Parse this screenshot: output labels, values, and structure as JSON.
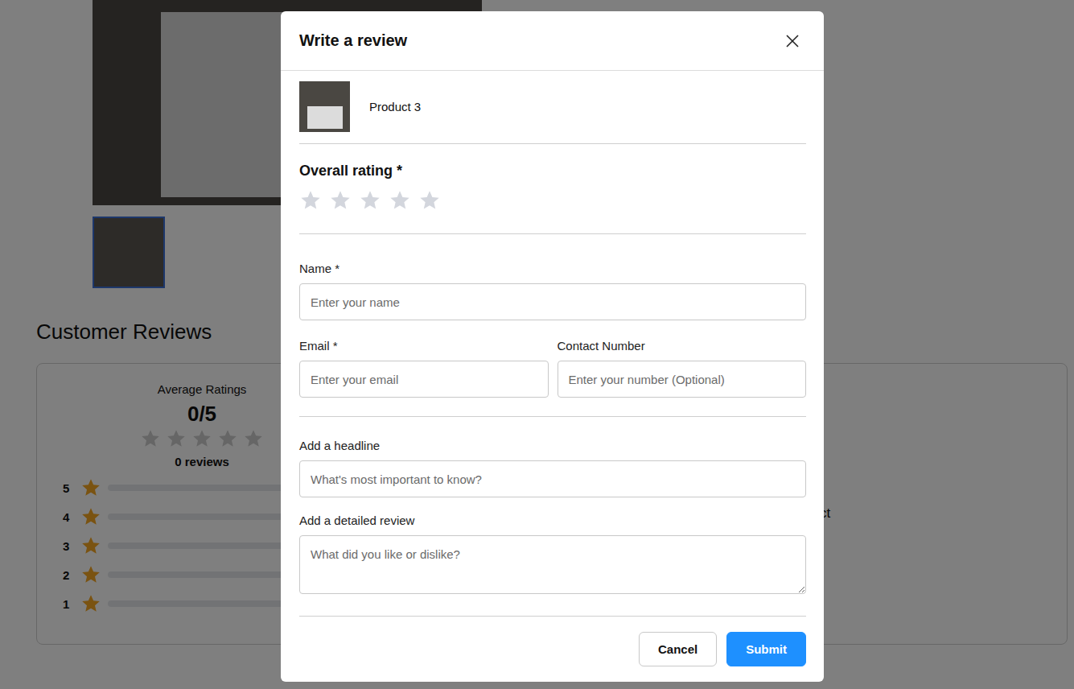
{
  "background": {
    "heading": "Customer Reviews",
    "summary": {
      "title": "Average Ratings",
      "score": "0/5",
      "stars": 0,
      "count": "0 reviews"
    },
    "bars": [
      {
        "label": "5",
        "level": 0
      },
      {
        "label": "4",
        "level": 0
      },
      {
        "label": "3",
        "level": 0
      },
      {
        "label": "2",
        "level": 0
      },
      {
        "label": "1",
        "level": 0
      }
    ],
    "side_text": "duct"
  },
  "modal": {
    "title": "Write a review",
    "product": {
      "name": "Product 3"
    },
    "rating": {
      "label": "Overall rating *",
      "stars": 0
    },
    "sections": [
      {
        "rows": [
          [
            {
              "label": "Name *",
              "placeholder": "Enter your name",
              "kind": "input"
            }
          ],
          [
            {
              "label": "Email *",
              "placeholder": "Enter your email",
              "kind": "input"
            },
            {
              "label": "Contact Number",
              "placeholder": "Enter your number (Optional)",
              "kind": "input"
            }
          ]
        ]
      },
      {
        "rows": [
          [
            {
              "label": "Add a headline",
              "placeholder": "What's most important to know?",
              "kind": "input"
            }
          ],
          [
            {
              "label": "Add a detailed review",
              "placeholder": "What did you like or dislike?",
              "kind": "textarea"
            }
          ]
        ]
      }
    ],
    "buttons": [
      {
        "label": "Cancel",
        "kind": "secondary"
      },
      {
        "label": "Submit",
        "kind": "primary"
      }
    ]
  }
}
